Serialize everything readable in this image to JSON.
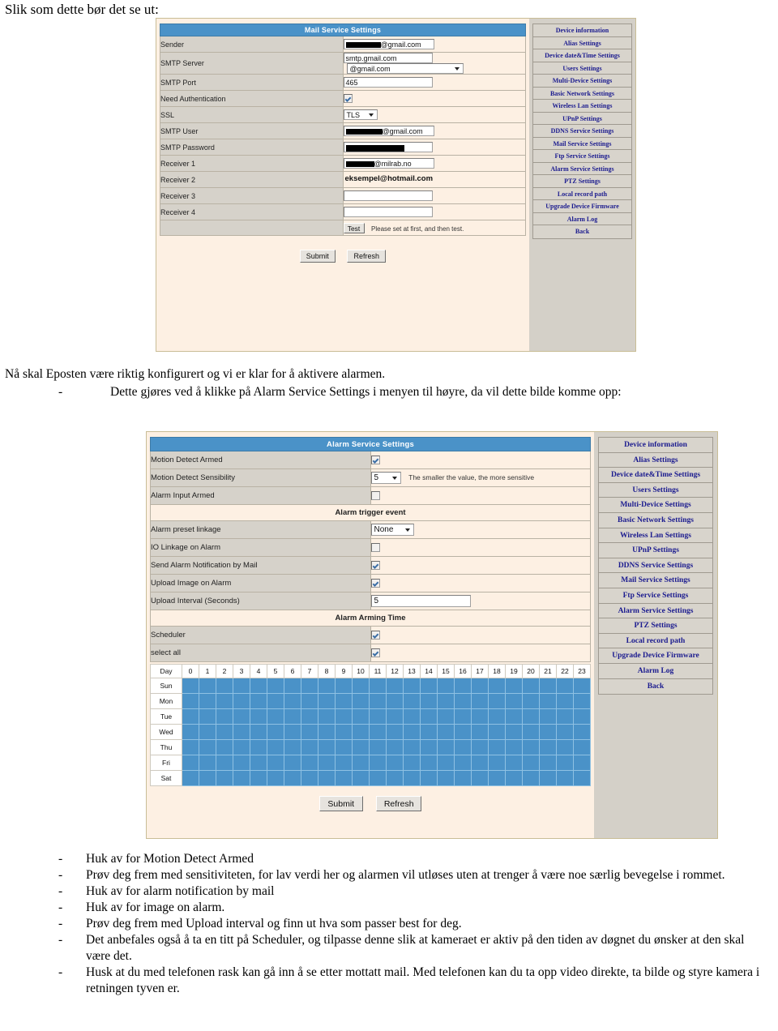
{
  "document": {
    "title": "Slik som dette bør det se ut:",
    "paragraph_1": "Nå skal Eposten være riktig konfigurert og vi er klar for å aktivere alarmen.",
    "bullet_after_p1_dash": "-",
    "bullet_after_p1": "Dette gjøres ved å klikke på Alarm Service Settings i menyen til høyre, da vil dette bilde komme opp:",
    "dash": "-",
    "bullets": [
      "Huk av for Motion Detect Armed",
      "Prøv deg frem med sensitiviteten, for lav verdi her og alarmen vil utløses uten at trenger å være noe særlig bevegelse i rommet.",
      "Huk av for alarm notification by mail",
      "Huk av for image on alarm.",
      "Prøv deg frem med Upload interval og finn ut hva som passer best for deg.",
      "Det anbefales også å ta en titt på Scheduler, og tilpasse denne slik at kameraet er aktiv på den tiden av døgnet du ønsker at den skal være det.",
      "Husk at du med telefonen rask kan gå inn å se etter mottatt mail. Med telefonen kan du ta opp video direkte, ta bilde og styre kamera i retningen tyven er."
    ]
  },
  "colors": {
    "header_blue": "#4a92c8",
    "panel_cream": "#fdf0e3",
    "label_gray": "#d6d2ca",
    "sidebar_gray": "#d4d0c8",
    "menu_link": "#1b1b8f",
    "schedule_selected": "#4a92c8"
  },
  "side_menu": {
    "items": [
      "Device information",
      "Alias Settings",
      "Device date&Time Settings",
      "Users Settings",
      "Multi-Device Settings",
      "Basic Network Settings",
      "Wireless Lan Settings",
      "UPnP Settings",
      "DDNS Service Settings",
      "Mail Service Settings",
      "Ftp Service Settings",
      "Alarm Service Settings",
      "PTZ Settings",
      "Local record path",
      "Upgrade Device Firmware",
      "Alarm Log",
      "Back"
    ]
  },
  "mail_settings": {
    "header": "Mail Service Settings",
    "rows": {
      "sender_label": "Sender",
      "sender_value": "@gmail.com",
      "smtp_server_label": "SMTP Server",
      "smtp_server_value": "smtp.gmail.com",
      "smtp_server_domain": "@gmail.com",
      "smtp_port_label": "SMTP Port",
      "smtp_port_value": "465",
      "need_auth_label": "Need Authentication",
      "ssl_label": "SSL",
      "ssl_value": "TLS",
      "smtp_user_label": "SMTP User",
      "smtp_user_value": "@gmail.com",
      "smtp_password_label": "SMTP Password",
      "receiver1_label": "Receiver 1",
      "receiver1_value": "@milrab.no",
      "receiver2_label": "Receiver 2",
      "receiver2_value": "eksempel@hotmail.com",
      "receiver3_label": "Receiver 3",
      "receiver3_value": "",
      "receiver4_label": "Receiver 4",
      "receiver4_value": "",
      "test_button": "Test",
      "test_note": "Please set at first, and then test."
    },
    "submit_label": "Submit",
    "refresh_label": "Refresh"
  },
  "alarm_settings": {
    "header": "Alarm Service Settings",
    "motion_detect_armed_label": "Motion Detect Armed",
    "motion_detect_sensibility_label": "Motion Detect Sensibility",
    "motion_detect_sensibility_value": "5",
    "motion_detect_sensibility_note": "The smaller the value, the more sensitive",
    "alarm_input_armed_label": "Alarm Input Armed",
    "alarm_trigger_event_header": "Alarm trigger event",
    "alarm_preset_linkage_label": "Alarm preset linkage",
    "alarm_preset_linkage_value": "None",
    "io_linkage_label": "IO Linkage on Alarm",
    "send_alarm_mail_label": "Send Alarm Notification by Mail",
    "upload_image_label": "Upload Image on Alarm",
    "upload_interval_label": "Upload Interval (Seconds)",
    "upload_interval_value": "5",
    "alarm_arming_time_header": "Alarm Arming Time",
    "scheduler_label": "Scheduler",
    "select_all_label": "select all",
    "submit_label": "Submit",
    "refresh_label": "Refresh",
    "schedule": {
      "day_header": "Day",
      "hours": [
        "0",
        "1",
        "2",
        "3",
        "4",
        "5",
        "6",
        "7",
        "8",
        "9",
        "10",
        "11",
        "12",
        "13",
        "14",
        "15",
        "16",
        "17",
        "18",
        "19",
        "20",
        "21",
        "22",
        "23"
      ],
      "days": [
        "Sun",
        "Mon",
        "Tue",
        "Wed",
        "Thu",
        "Fri",
        "Sat"
      ],
      "all_selected": true
    }
  }
}
